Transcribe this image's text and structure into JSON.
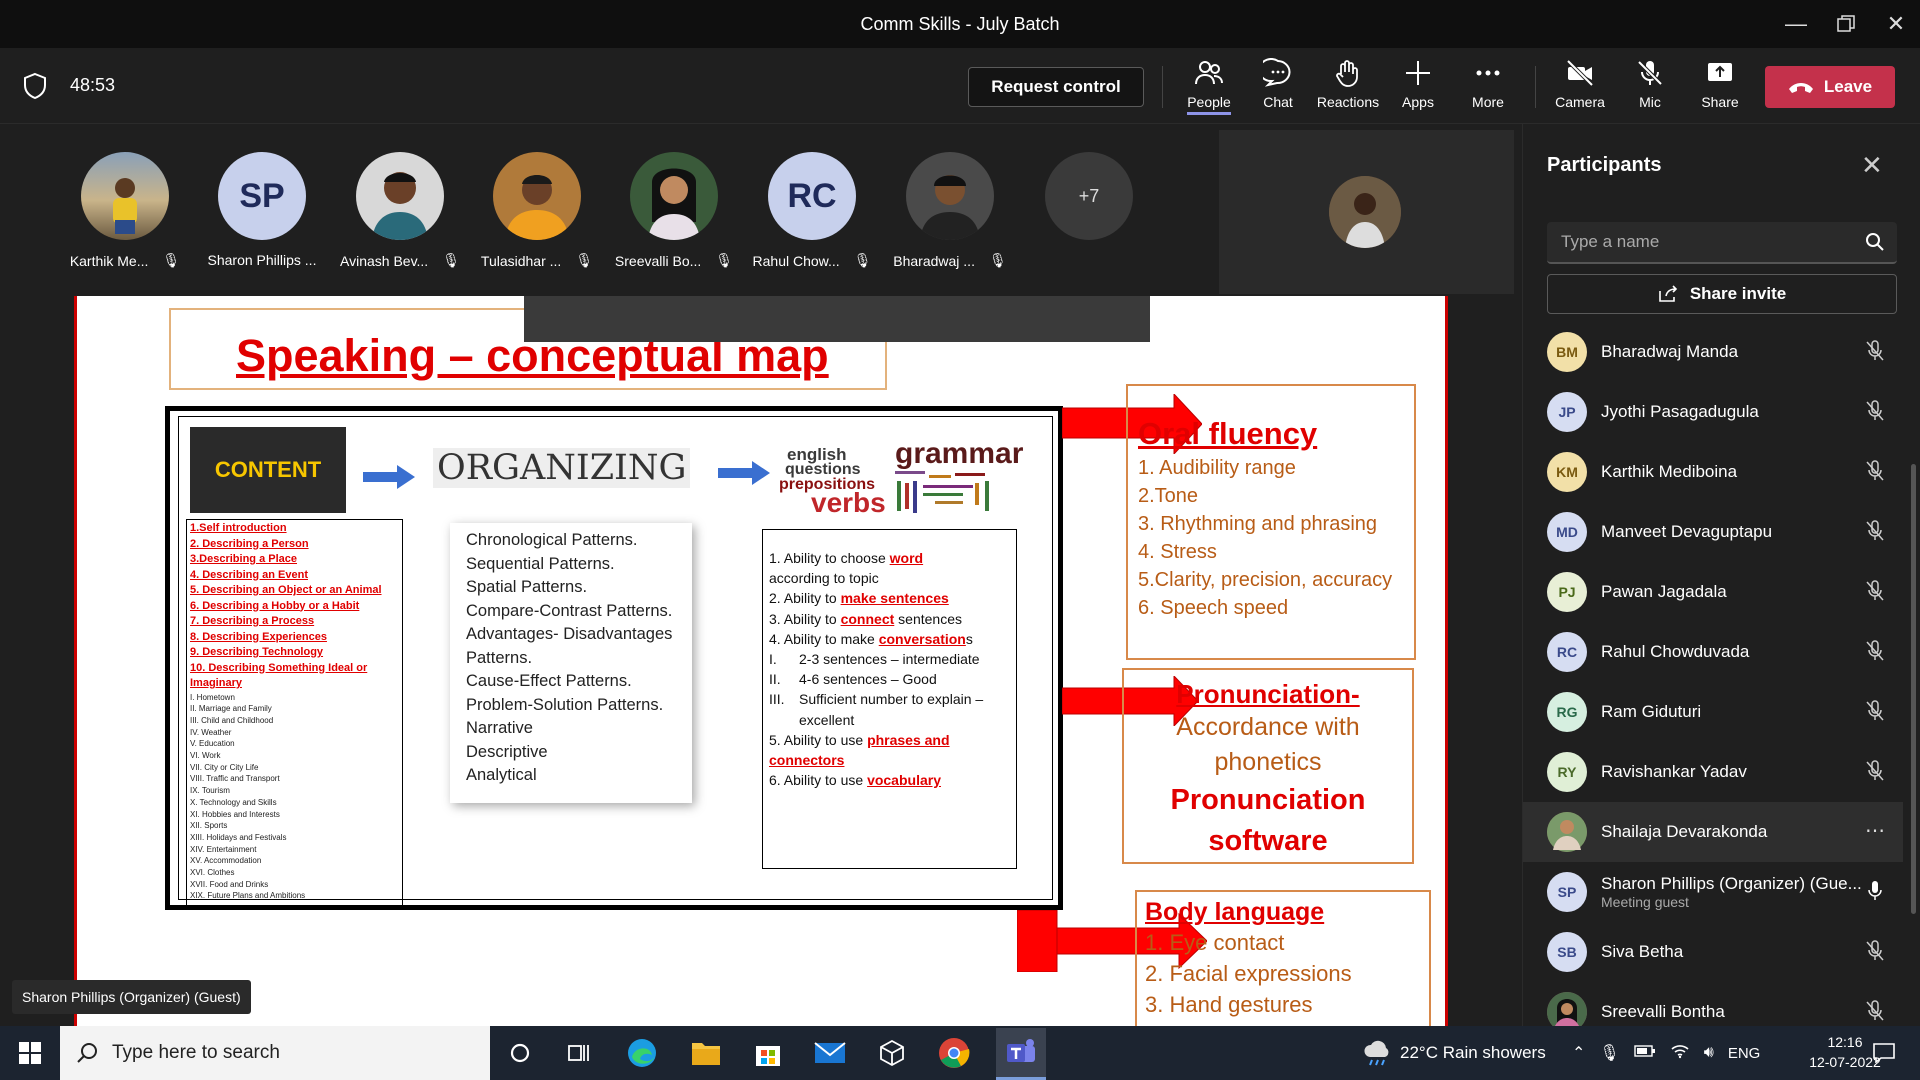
{
  "window": {
    "title": "Comm Skills - July Batch"
  },
  "toolbar": {
    "timer": "48:53",
    "request_control": "Request control",
    "people": "People",
    "chat": "Chat",
    "reactions": "Reactions",
    "apps": "Apps",
    "more": "More",
    "camera": "Camera",
    "mic": "Mic",
    "share": "Share",
    "leave": "Leave"
  },
  "gallery": {
    "participants": [
      {
        "name": "Karthik Me...",
        "initials": ""
      },
      {
        "name": "Sharon Phillips ...",
        "initials": "SP"
      },
      {
        "name": "Avinash Bev...",
        "initials": ""
      },
      {
        "name": "Tulasidhar ...",
        "initials": ""
      },
      {
        "name": "Sreevalli Bo...",
        "initials": ""
      },
      {
        "name": "Rahul Chow...",
        "initials": "RC"
      },
      {
        "name": "Bharadwaj ...",
        "initials": ""
      }
    ],
    "overflow": "+7"
  },
  "slide": {
    "title": "Speaking – conceptual map",
    "content_label": "CONTENT",
    "organizing": "ORGANIZING",
    "grammar_words": {
      "english": "english",
      "questions": "questions",
      "prepositions": "prepositions",
      "verbs": "verbs",
      "grammar": "grammar"
    },
    "content_list_red": [
      "1.Self introduction",
      "2. Describing a Person",
      "3.Describing a Place",
      "4. Describing an Event",
      "5. Describing an Object or an Animal",
      "6. Describing a Hobby or a Habit",
      "7. Describing a Process",
      "8. Describing Experiences",
      "9. Describing Technology",
      "10. Describing Something Ideal or Imaginary"
    ],
    "content_list_small": [
      "I. Hometown",
      "II. Marriage and Family",
      "III. Child and Childhood",
      "IV. Weather",
      "V. Education",
      "VI. Work",
      "VII. City or City Life",
      "VIII. Traffic and Transport",
      "IX. Tourism",
      "X. Technology and Skills",
      "XI. Hobbies and Interests",
      "XII. Sports",
      "XIII. Holidays and Festivals",
      "XIV. Entertainment",
      "XV. Accommodation",
      "XVI. Clothes",
      "XVII. Food and Drinks",
      "XIX. Future Plans and Ambitions"
    ],
    "organizing_list": [
      "Chronological Patterns.",
      "Sequential Patterns.",
      "Spatial Patterns.",
      "Compare-Contrast Patterns.",
      "Advantages- Disadvantages",
      "Patterns.",
      "Cause-Effect Patterns.",
      "Problem-Solution Patterns.",
      "Narrative",
      "Descriptive",
      "Analytical"
    ],
    "ability": {
      "l1a": "1. Ability to choose ",
      "l1b": "word",
      "l1c": "according to topic",
      "l2a": "2. Ability to ",
      "l2b": "make sentences",
      "l3a": "3. Ability to ",
      "l3b": "connect",
      "l3c": " sentences",
      "l4a": "4. Ability to make ",
      "l4b": "conversation",
      "l4c": "s",
      "r1n": "I.",
      "r1": "2-3 sentences – intermediate",
      "r2n": "II.",
      "r2": "4-6 sentences – Good",
      "r3n": "III.",
      "r3": "Sufficient number to explain – excellent",
      "l5a": "5. Ability to use ",
      "l5b": "phrases and connectors",
      "l6a": "6. Ability to use ",
      "l6b": "vocabulary"
    },
    "oral": {
      "heading": "Oral fluency",
      "items": [
        "1.     Audibility range",
        "2.Tone",
        "3. Rhythming and phrasing",
        "4. Stress",
        "5.Clarity, precision, accuracy",
        "6. Speech speed"
      ]
    },
    "pron": {
      "heading": "Pronunciation-",
      "line1": "Accordance with",
      "line2": "phonetics",
      "line3": "Pronunciation",
      "line4": "software"
    },
    "body": {
      "heading": "Body language",
      "items": [
        "1.    Eye contact",
        "2.    Facial expressions",
        "3.    Hand gestures"
      ]
    }
  },
  "speaker_label": "Sharon Phillips (Organizer) (Guest)",
  "panel": {
    "title": "Participants",
    "search_placeholder": "Type a name",
    "share_invite": "Share invite",
    "people": [
      {
        "initials": "BM",
        "name": "Bharadwaj Manda",
        "color": "#f2e0a8"
      },
      {
        "initials": "JP",
        "name": "Jyothi Pasagadugula",
        "color": "#d6ddf2"
      },
      {
        "initials": "KM",
        "name": "Karthik Mediboina",
        "color": "#f2e0a8"
      },
      {
        "initials": "MD",
        "name": "Manveet Devaguptapu",
        "color": "#d6ddf2"
      },
      {
        "initials": "PJ",
        "name": "Pawan Jagadala",
        "color": "#e8efd6"
      },
      {
        "initials": "RC",
        "name": "Rahul Chowduvada",
        "color": "#d6ddf2"
      },
      {
        "initials": "RG",
        "name": "Ram Giduturi",
        "color": "#d6efe0"
      },
      {
        "initials": "RY",
        "name": "Ravishankar Yadav",
        "color": "#e0efd6"
      },
      {
        "initials": "",
        "name": "Shailaja Devarakonda",
        "color": "#8a6b50"
      },
      {
        "initials": "SP",
        "name": "Sharon Phillips (Organizer) (Gue...",
        "sub": "Meeting guest",
        "color": "#d6ddf2"
      },
      {
        "initials": "SB",
        "name": "Siva Betha",
        "color": "#d6ddf2"
      },
      {
        "initials": "",
        "name": "Sreevalli Bontha",
        "color": "#9a5a6a"
      }
    ]
  },
  "taskbar": {
    "search": "Type here to search",
    "weather": "22°C  Rain showers",
    "lang": "ENG",
    "time": "12:16",
    "date": "12-07-2022"
  }
}
